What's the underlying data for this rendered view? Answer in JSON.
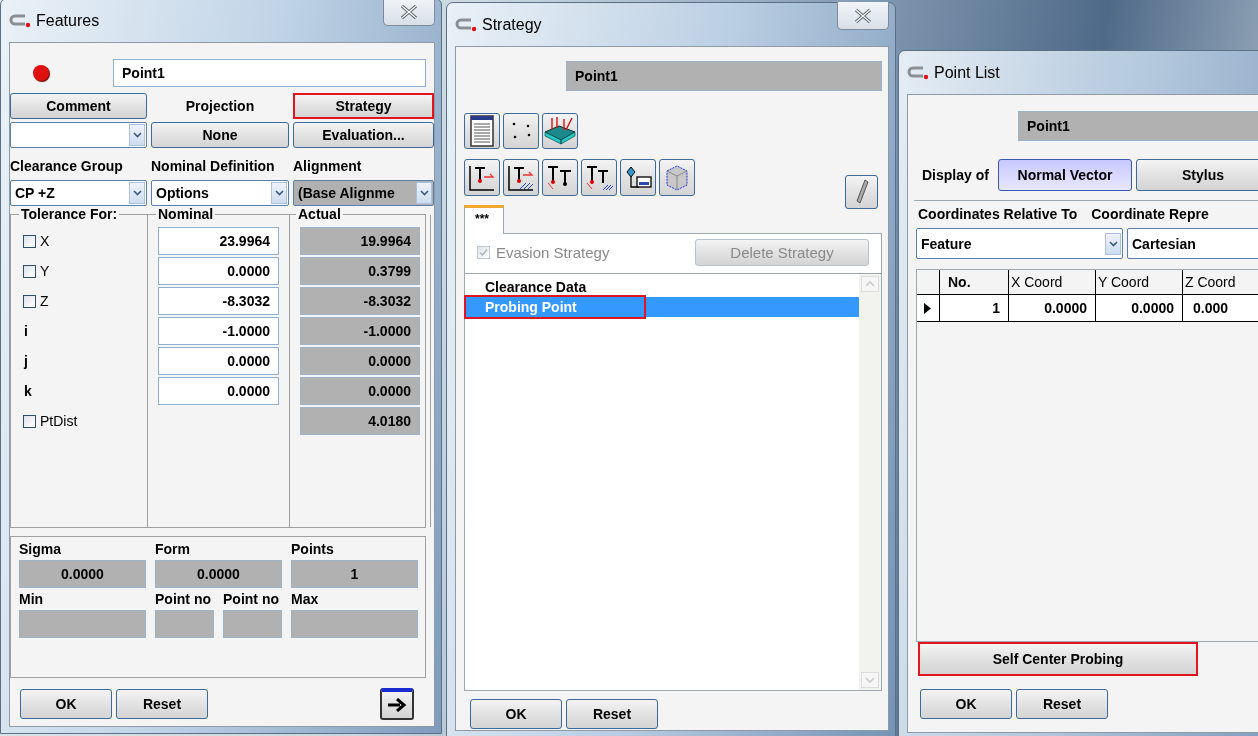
{
  "features": {
    "title": "Features",
    "name": "Point1",
    "row_1": [
      {
        "kind": "button",
        "label": "Comment",
        "annotated": false
      },
      {
        "kind": "label",
        "label": "Projection"
      },
      {
        "kind": "button",
        "label": "Strategy",
        "annotated": true
      }
    ],
    "row_2": [
      {
        "kind": "dropdown"
      },
      {
        "kind": "button",
        "label": "None"
      },
      {
        "kind": "button",
        "label": "Evaluation..."
      }
    ],
    "labels": [
      "Clearance Group",
      "Nominal Definition",
      "Alignment"
    ],
    "dropdowns": [
      {
        "value": "CP +Z",
        "disabled": false
      },
      {
        "value": "Options",
        "disabled": false
      },
      {
        "value": "(Base Alignme",
        "disabled": true
      }
    ],
    "tolerance_headers": [
      "Tolerance For:",
      "Nominal",
      "Actual"
    ],
    "tolerance_rows": [
      {
        "kind": "checkbox",
        "label": "X",
        "checked": false,
        "nominal": "23.9964",
        "actual": "19.9964"
      },
      {
        "kind": "checkbox",
        "label": "Y",
        "checked": false,
        "nominal": "0.0000",
        "actual": "0.3799"
      },
      {
        "kind": "checkbox",
        "label": "Z",
        "checked": false,
        "nominal": "-8.3032",
        "actual": "-8.3032"
      },
      {
        "kind": "plain",
        "label": "i",
        "nominal": "-1.0000",
        "actual": "-1.0000"
      },
      {
        "kind": "plain",
        "label": "j",
        "nominal": "0.0000",
        "actual": "0.0000"
      },
      {
        "kind": "plain",
        "label": "k",
        "nominal": "0.0000",
        "actual": "0.0000"
      },
      {
        "kind": "checkbox",
        "label": "PtDist",
        "checked": false,
        "actual": "4.0180"
      }
    ],
    "stats_top": [
      {
        "label": "Sigma",
        "value": "0.0000"
      },
      {
        "label": "Form",
        "value": "0.0000"
      },
      {
        "label": "Points",
        "value": "1"
      }
    ],
    "stats_bottom": [
      {
        "label": "Min"
      },
      {
        "label": "Point no"
      },
      {
        "label": "Point no"
      },
      {
        "label": "Max"
      }
    ],
    "buttons": [
      "OK",
      "Reset"
    ]
  },
  "strategy": {
    "title": "Strategy",
    "name": "Point1",
    "tabs": [
      {
        "label": "***",
        "selected": true
      }
    ],
    "evasion": {
      "label": "Evasion Strategy",
      "checked": true,
      "disabled": true
    },
    "delete_button": {
      "label": "Delete Strategy",
      "disabled": true
    },
    "items": [
      {
        "label": "Clearance Data",
        "selected": false,
        "annotated": false
      },
      {
        "label": "Probing Point",
        "selected": true,
        "annotated": true
      }
    ],
    "buttons": [
      "OK",
      "Reset"
    ]
  },
  "point_list": {
    "title": "Point List",
    "name": "Point1",
    "display_label": "Display of",
    "display_options": [
      {
        "label": "Normal Vector",
        "selected": true
      },
      {
        "label": "Stylus",
        "selected": false
      }
    ],
    "labels": [
      "Coordinates Relative To",
      "Coordinate Repre"
    ],
    "dropdowns": [
      {
        "value": "Feature",
        "kind": "dropdown"
      },
      {
        "value": "Cartesian",
        "kind": "field"
      }
    ],
    "table": {
      "columns": [
        "No.",
        "X Coord",
        "Y Coord",
        "Z Coord"
      ],
      "rows": [
        {
          "current": true,
          "cells": [
            "1",
            "0.0000",
            "0.0000",
            "0.000"
          ]
        }
      ]
    },
    "self_center_button": {
      "label": "Self Center Probing",
      "annotated": true
    },
    "buttons": [
      "OK",
      "Reset"
    ]
  }
}
